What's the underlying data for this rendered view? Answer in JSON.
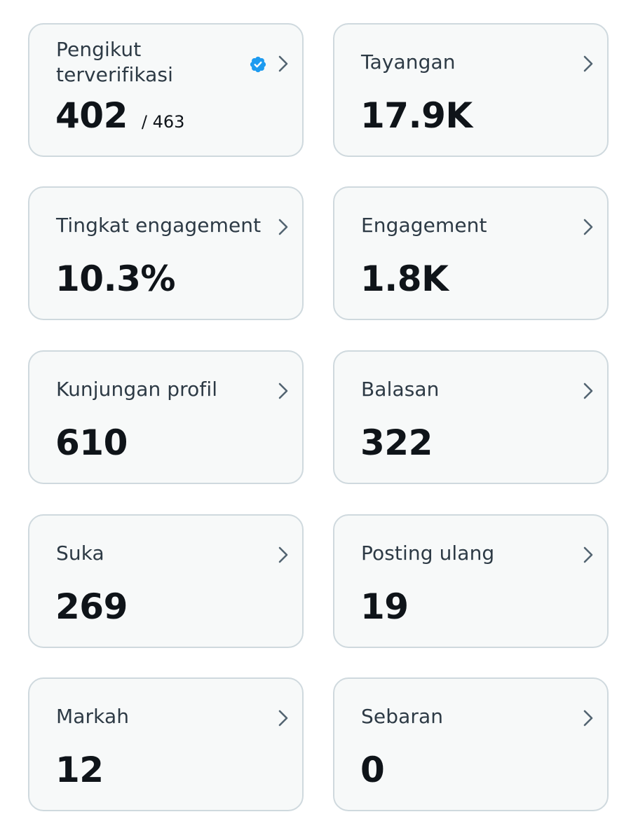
{
  "accent_color": "#1d9bf0",
  "cards": [
    {
      "label": "Pengikut terverifikasi",
      "value": "402",
      "subvalue": "/ 463",
      "icon": "verified-badge-icon"
    },
    {
      "label": "Tayangan",
      "value": "17.9K"
    },
    {
      "label": "Tingkat engagement",
      "value": "10.3%"
    },
    {
      "label": "Engagement",
      "value": "1.8K"
    },
    {
      "label": "Kunjungan profil",
      "value": "610"
    },
    {
      "label": "Balasan",
      "value": "322"
    },
    {
      "label": "Suka",
      "value": "269"
    },
    {
      "label": "Posting ulang",
      "value": "19"
    },
    {
      "label": "Markah",
      "value": "12"
    },
    {
      "label": "Sebaran",
      "value": "0"
    }
  ],
  "chevron_icon": "chevron-right-icon"
}
